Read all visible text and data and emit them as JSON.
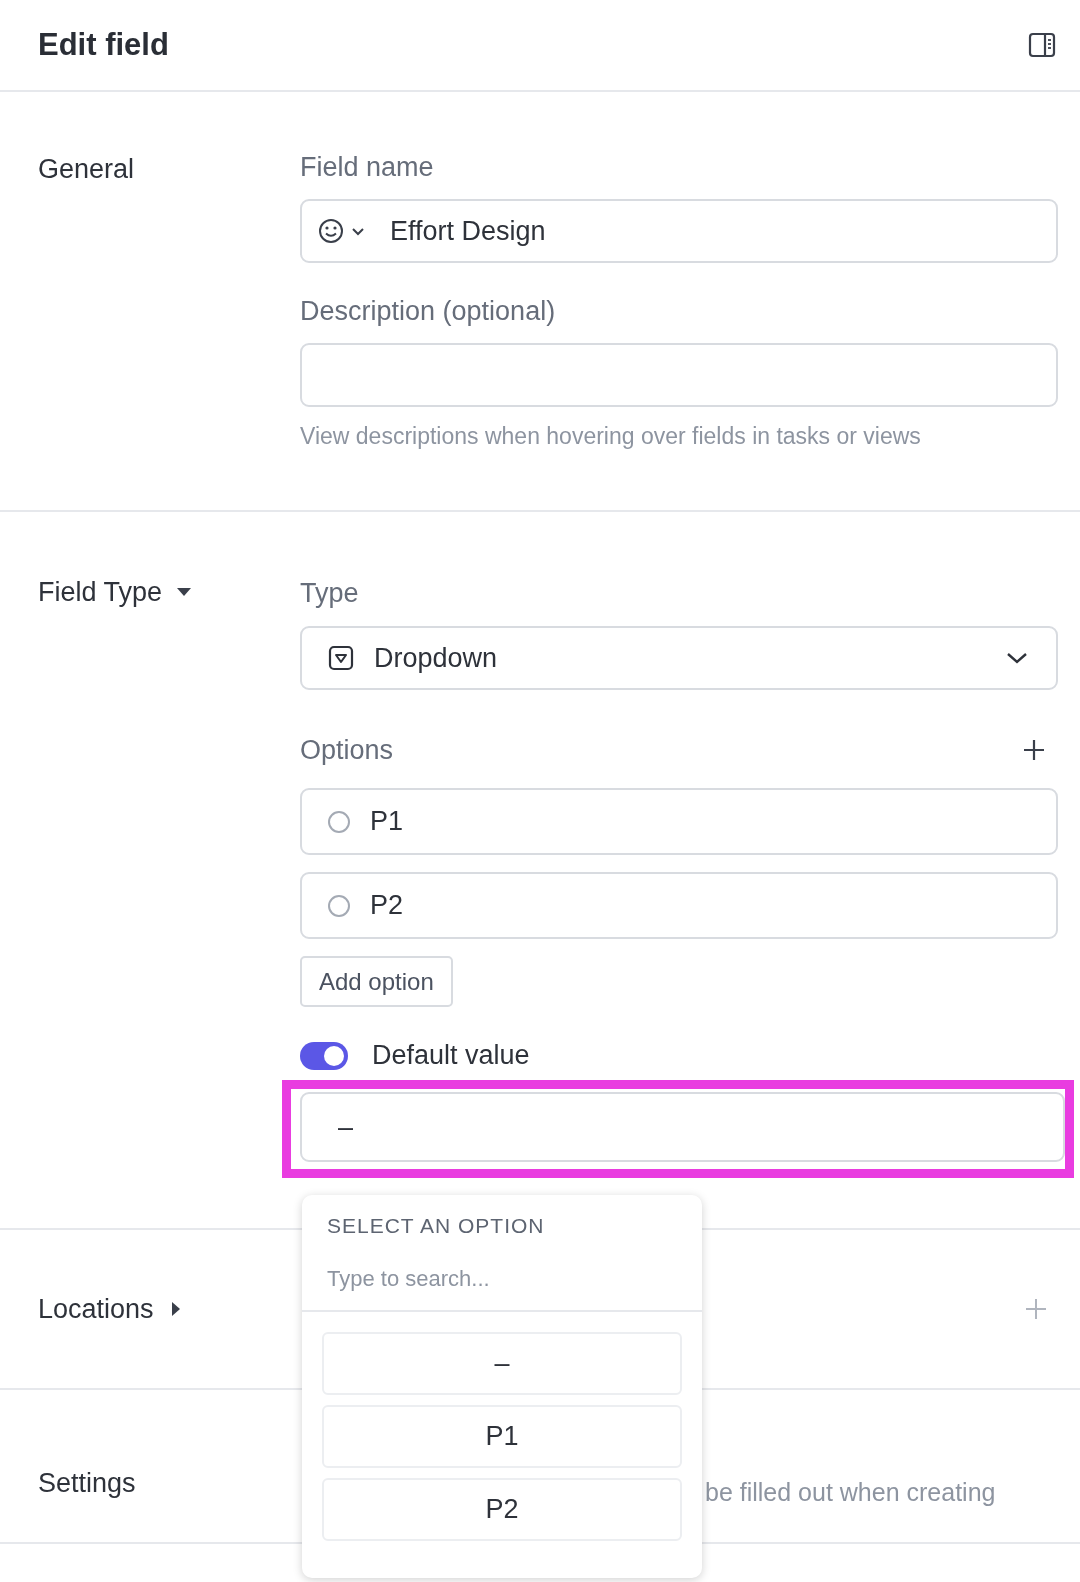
{
  "header": {
    "title": "Edit field"
  },
  "general": {
    "label": "General",
    "field_name": {
      "label": "Field name",
      "value": "Effort Design"
    },
    "description": {
      "label": "Description",
      "qualifier": "(optional)",
      "help": "View descriptions when hovering over fields in tasks or views"
    }
  },
  "field_type": {
    "label": "Field Type",
    "expanded": true,
    "type": {
      "label": "Type",
      "value": "Dropdown"
    },
    "options_label": "Options",
    "options": [
      {
        "label": "P1",
        "selected": false
      },
      {
        "label": "P2",
        "selected": false
      }
    ],
    "add_option": "Add option",
    "default_value": {
      "label": "Default value",
      "on": true,
      "value": "–"
    }
  },
  "locations": {
    "label": "Locations",
    "expanded": false
  },
  "settings": {
    "label": "Settings",
    "text": "be filled out when creating"
  },
  "popup": {
    "title": "SELECT AN OPTION",
    "search_placeholder": "Type to search...",
    "items": [
      "–",
      "P1",
      "P2"
    ]
  }
}
